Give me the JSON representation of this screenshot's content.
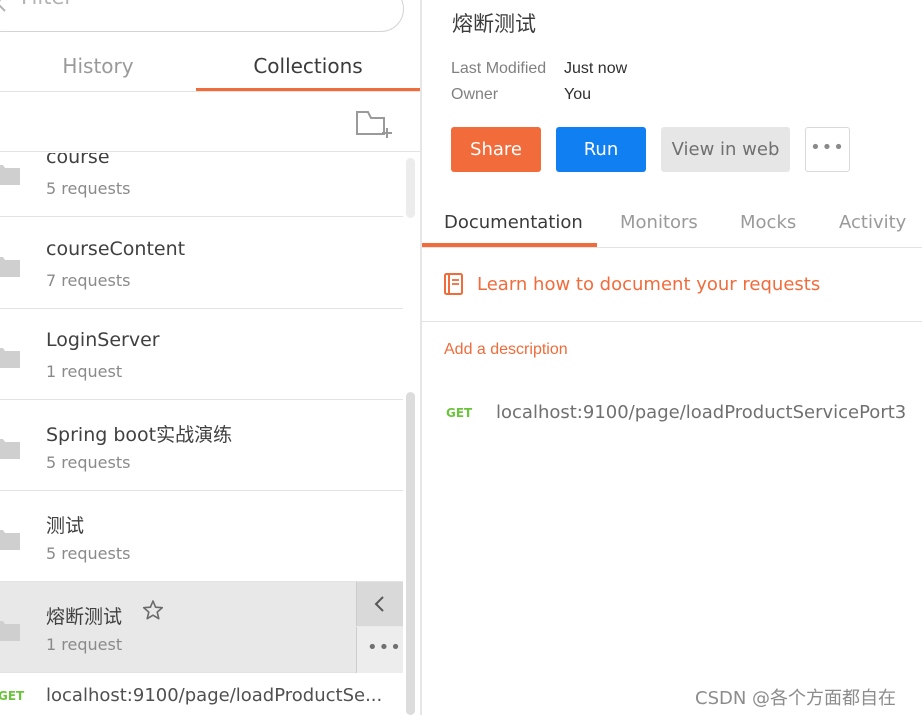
{
  "sidebar": {
    "filter_placeholder": "Filter",
    "tabs": {
      "history": "History",
      "collections": "Collections"
    },
    "collections": [
      {
        "name": "course",
        "count": "5 requests"
      },
      {
        "name": "courseContent",
        "count": "7 requests"
      },
      {
        "name": "LoginServer",
        "count": "1 request"
      },
      {
        "name": "Spring boot实战演练",
        "count": "5 requests"
      },
      {
        "name": "测试",
        "count": "5 requests"
      },
      {
        "name": "熔断测试",
        "count": "1 request"
      }
    ],
    "request": {
      "method": "GET",
      "url": "localhost:9100/page/loadProductSe..."
    }
  },
  "detail": {
    "title": "熔断测试",
    "last_modified_label": "Last Modified",
    "last_modified_value": "Just now",
    "owner_label": "Owner",
    "owner_value": "You",
    "buttons": {
      "share": "Share",
      "run": "Run",
      "view_web": "View in web",
      "more": "•••"
    },
    "tabs": {
      "documentation": "Documentation",
      "monitors": "Monitors",
      "mocks": "Mocks",
      "activity": "Activity"
    },
    "learn_link": "Learn how to document your requests",
    "add_description": "Add a description",
    "request": {
      "method": "GET",
      "url": "localhost:9100/page/loadProductServicePort3"
    }
  },
  "colors": {
    "accent": "#f26b3a",
    "run_blue": "#0f7ff2",
    "get_green": "#6bc53c"
  },
  "watermark": "CSDN @各个方面都自在"
}
